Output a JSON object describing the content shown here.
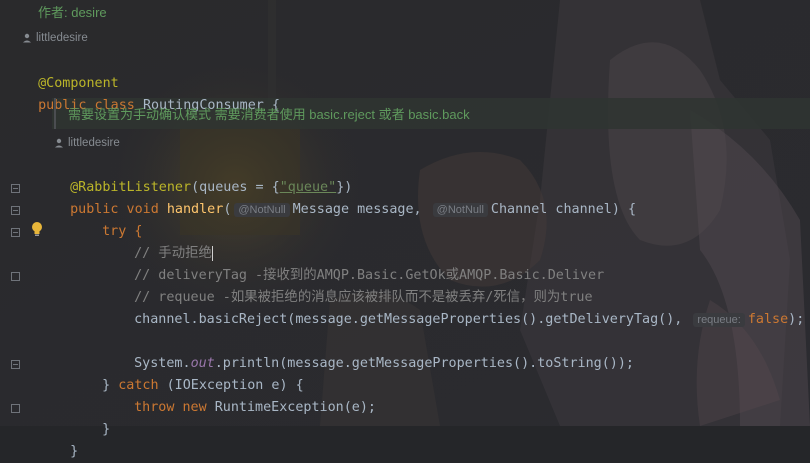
{
  "editor": {
    "top_doc": "作者: desire",
    "author1": "littledesire",
    "author2": "littledesire",
    "class_doc": "需要设置为手动确认模式 需要消费者使用 basic.reject 或者 basic.back",
    "colors": {
      "background": "#252629",
      "keyword": "#cc7832",
      "annotation": "#bbb529",
      "method": "#ffc66d",
      "string": "#6a8759",
      "comment": "#808080",
      "doc": "#5f9a5d"
    }
  },
  "code": {
    "l_component": "@Component",
    "l_class_kw": "public class ",
    "l_class_name": "RoutingConsumer {",
    "l_listener_ann": "@RabbitListener",
    "l_listener_open": "(queues = {",
    "l_listener_str": "\"queue\"",
    "l_listener_close": "})",
    "l_handler_kw": "public void ",
    "l_handler_name": "handler",
    "l_handler_p1": "(",
    "hint_notnull1": "@NotNull",
    "l_handler_p2": "Message message, ",
    "hint_notnull2": "@NotNull",
    "l_handler_p3": "Channel channel) {",
    "l_try": "try {",
    "c1": "// 手动拒绝",
    "c2": "// deliveryTag -接收到的AMQP.Basic.GetOk或AMQP.Basic.Deliver",
    "c3": "// requeue -如果被拒绝的消息应该被排队而不是被丢弃/死信，则为true",
    "reject_a": "channel.basicReject(message.getMessageProperties().getDeliveryTag(), ",
    "hint_requeue": "requeue:",
    "reject_b": "false",
    "reject_c": ");",
    "sys_a": "System.",
    "sys_out": "out",
    "sys_b": ".println(message.getMessageProperties().toString());",
    "catch_a": "} ",
    "catch_kw": "catch",
    "catch_b": " (IOException e) {",
    "throw_kw": "throw new ",
    "throw_b": "RuntimeException(e);",
    "close_brace": "}",
    "last_brace": "}"
  }
}
